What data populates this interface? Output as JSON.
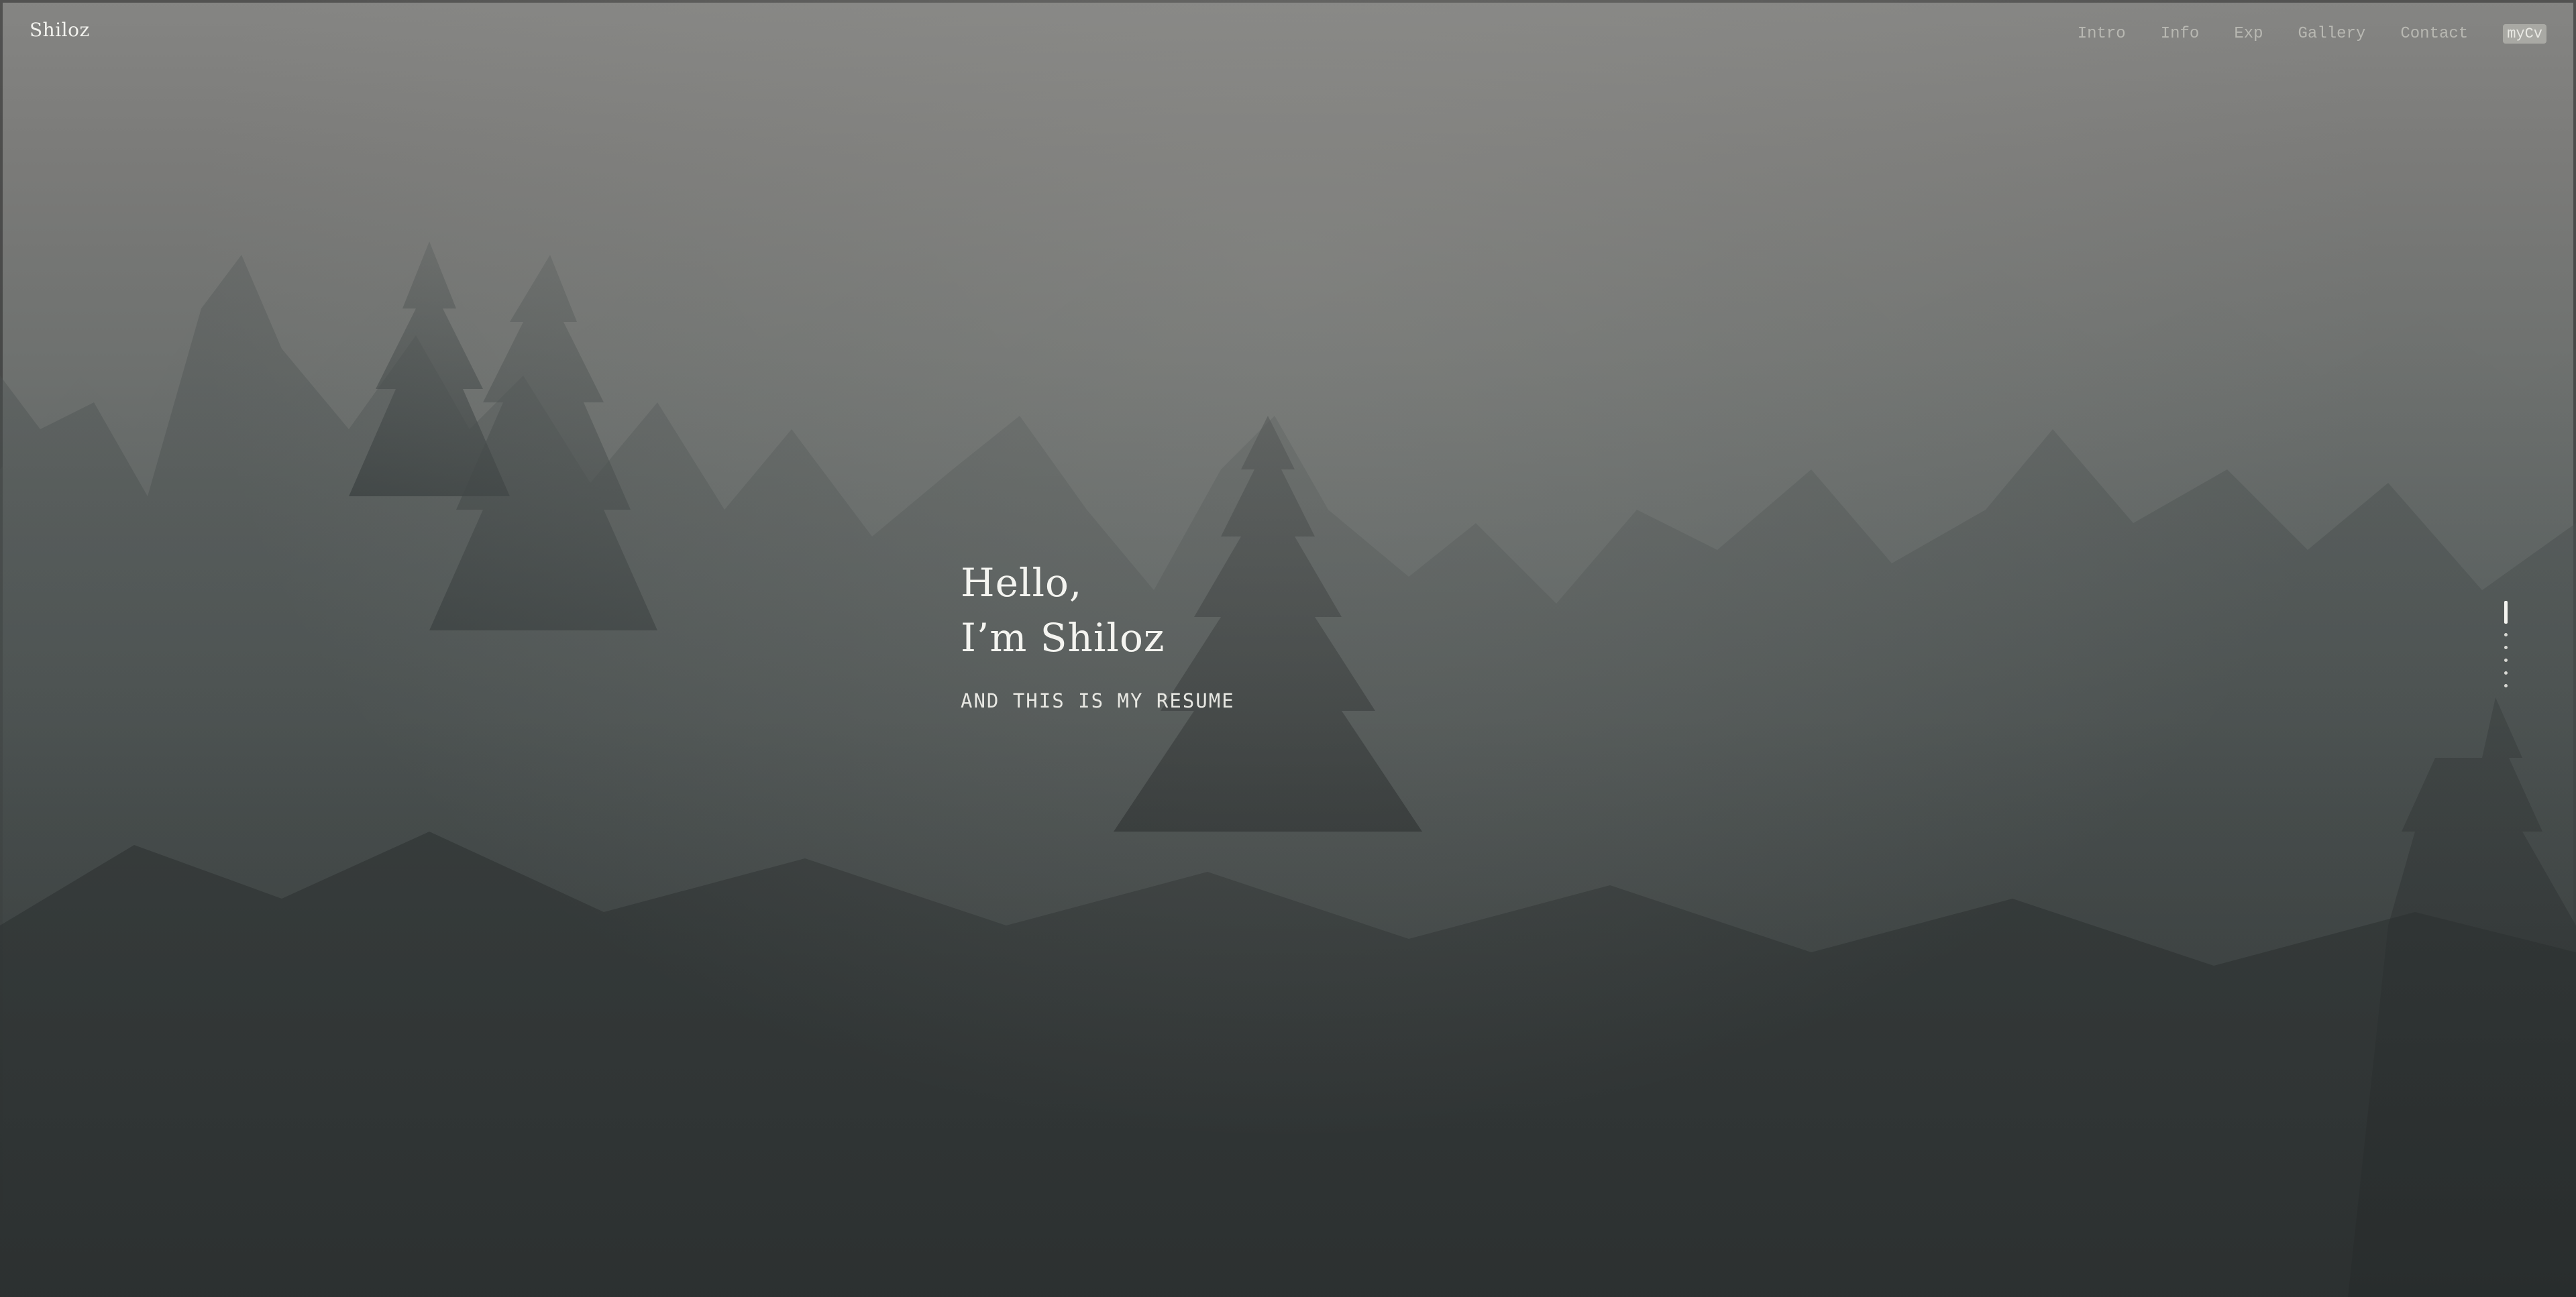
{
  "header": {
    "brand": "Shiloz",
    "nav": [
      {
        "label": "Intro"
      },
      {
        "label": "Info"
      },
      {
        "label": "Exp"
      },
      {
        "label": "Gallery"
      },
      {
        "label": "Contact"
      },
      {
        "label": "myCv"
      }
    ]
  },
  "hero": {
    "greeting": "Hello,",
    "name_line": "I’m Shiloz",
    "subtitle": "AND THIS IS MY RESUME"
  },
  "section_nav": {
    "active_index": 0,
    "count": 6
  },
  "colors": {
    "text": "#f4f4f0",
    "nav_text": "#b8b8b2",
    "background_fog": "#858583",
    "background_forest": "#323636"
  }
}
